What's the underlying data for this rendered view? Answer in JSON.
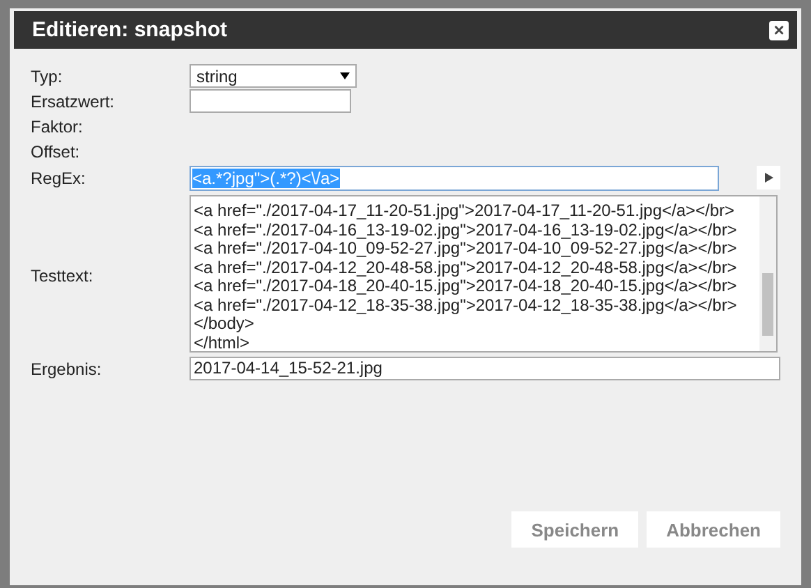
{
  "dialog": {
    "title": "Editieren: snapshot",
    "close": "×"
  },
  "fields": [
    {
      "label": "Typ:",
      "kind": "select",
      "value": "string"
    },
    {
      "label": "Ersatzwert:",
      "kind": "input"
    },
    {
      "label": "Faktor:",
      "kind": "none"
    },
    {
      "label": "Offset:",
      "kind": "none"
    },
    {
      "label": "RegEx:",
      "kind": "regex",
      "value": "<a.*?jpg\">(.*?)<\\/a>",
      "text_selected": true
    },
    {
      "label": "Testtext:",
      "kind": "textarea",
      "lines": [
        "<a href=\"./2017-04-17_11-20-51.jpg\">2017-04-17_11-20-51.jpg</a></br>",
        "<a href=\"./2017-04-16_13-19-02.jpg\">2017-04-16_13-19-02.jpg</a></br>",
        "<a href=\"./2017-04-10_09-52-27.jpg\">2017-04-10_09-52-27.jpg</a></br>",
        "<a href=\"./2017-04-12_20-48-58.jpg\">2017-04-12_20-48-58.jpg</a></br>",
        "<a href=\"./2017-04-18_20-40-15.jpg\">2017-04-18_20-40-15.jpg</a></br>",
        "<a href=\"./2017-04-12_18-35-38.jpg\">2017-04-12_18-35-38.jpg</a></br>",
        "</body>",
        "</html>"
      ]
    },
    {
      "label": "Ergebnis:",
      "kind": "output",
      "value": "2017-04-14_15-52-21.jpg"
    }
  ],
  "buttons": [
    "Speichern",
    "Abbrechen"
  ]
}
